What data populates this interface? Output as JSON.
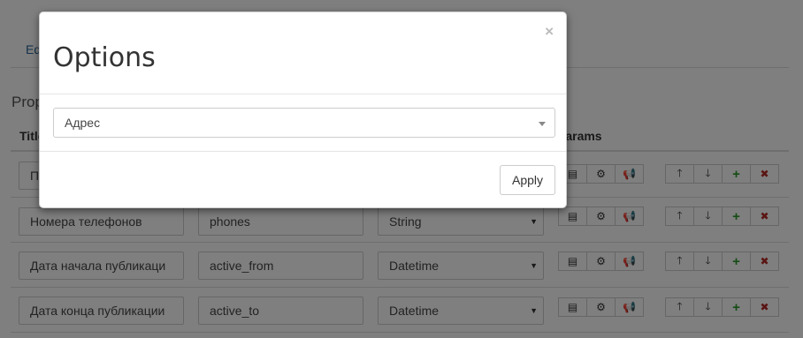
{
  "background": {
    "tab_label": "Ed",
    "section_title": "Prop",
    "table_headers": {
      "title": "Title",
      "params": "Params"
    },
    "rows": [
      {
        "title": "П",
        "code": "",
        "type": ""
      },
      {
        "title": "Номера телефонов",
        "code": "phones",
        "type": "String"
      },
      {
        "title": "Дата начала публикаци",
        "code": "active_from",
        "type": "Datetime"
      },
      {
        "title": "Дата конца публикации",
        "code": "active_to",
        "type": "Datetime"
      }
    ],
    "row_buttons": {
      "params": [
        "list-icon",
        "gear-icon",
        "megaphone-icon"
      ],
      "actions": [
        "arrow-up-icon",
        "arrow-down-icon",
        "plus-icon",
        "remove-icon"
      ]
    }
  },
  "modal": {
    "title": "Options",
    "close_glyph": "×",
    "select_value": "Адрес",
    "apply_label": "Apply"
  },
  "colors": {
    "overlay": "rgba(0,0,0,0.5)",
    "plus": "#2a9a2a",
    "remove": "#b52b27",
    "link": "#2a6496"
  }
}
